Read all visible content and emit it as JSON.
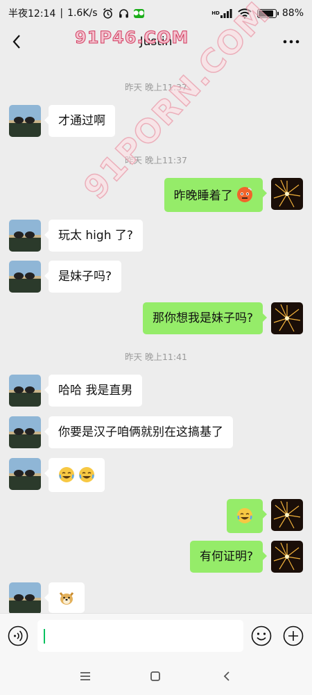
{
  "status_bar": {
    "time": "半夜12:14",
    "speed": "1.6K/s",
    "separator": "|",
    "hd_label": "HD",
    "battery_text": "88%",
    "battery_level": 0.88,
    "icons": [
      "alarm-icon",
      "headphones-icon",
      "wechat-icon",
      "signal-icon",
      "wifi-icon",
      "battery-icon"
    ]
  },
  "header": {
    "title": "Justin",
    "watermark": "91P46.COM",
    "back_icon": "chevron-left-icon",
    "more_icon": "more-dots-icon"
  },
  "watermark_diag": "91PORN.COM",
  "timestamps": [
    "昨天 晚上11:37",
    "昨天 晚上11:37",
    "昨天 晚上11:41"
  ],
  "messages": [
    {
      "side": "left",
      "text": "才通过啊"
    },
    {
      "side": "right",
      "text": "昨晚睡着了",
      "emoji": "face-with-steam-emoji"
    },
    {
      "side": "left",
      "text": "玩太 high 了?"
    },
    {
      "side": "left",
      "text": "是妹子吗?"
    },
    {
      "side": "right",
      "text": "那你想我是妹子吗?"
    },
    {
      "side": "left",
      "text": "哈哈 我是直男"
    },
    {
      "side": "left",
      "text": "你要是汉子咱俩就别在这搞基了"
    },
    {
      "side": "left",
      "emoji": "tears-of-joy-emoji x2"
    },
    {
      "side": "right",
      "emoji": "tears-of-joy-emoji"
    },
    {
      "side": "right",
      "text": "有何证明?"
    },
    {
      "side": "left",
      "emoji": "doge-emoji"
    }
  ],
  "input_bar": {
    "value": "",
    "icons": [
      "voice-icon",
      "smiley-icon",
      "plus-icon"
    ]
  },
  "nav_bar": {
    "icons": [
      "menu-icon",
      "home-icon",
      "back-icon"
    ]
  },
  "colors": {
    "background": "#ededed",
    "my_bubble": "#95ec69",
    "their_bubble": "#ffffff",
    "accent": "#07c160"
  }
}
